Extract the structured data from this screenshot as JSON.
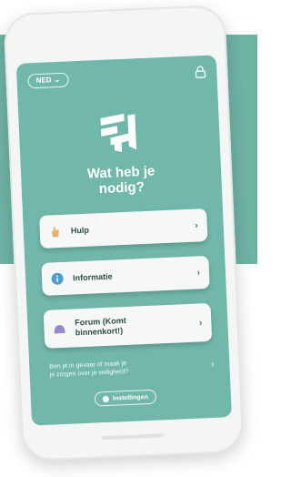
{
  "header": {
    "language_label": "NED",
    "language_caret": "⌄",
    "top_right_icon": "lock-icon"
  },
  "main": {
    "title_line1": "Wat heb je",
    "title_line2": "nodig?"
  },
  "options": [
    {
      "label": "Hulp",
      "icon": "hand-icon",
      "chevron": "›"
    },
    {
      "label": "Informatie",
      "icon": "info-icon",
      "chevron": "›"
    },
    {
      "label_line1": "Forum (Komt",
      "label_line2": "binnenkort!)",
      "icon": "chat-bubbles-icon",
      "chevron": "›"
    }
  ],
  "footer": {
    "note_line1": "Ben je in gevaar of maak je",
    "note_line2": "je zorgen over je veiligheid?",
    "note_chevron": "›",
    "pill_label": "Instellingen"
  },
  "colors": {
    "brand": "#72b8aa",
    "band": "#6fb3a5",
    "card": "#f6f8f7",
    "hand_icon": "#e8b16a",
    "info_icon": "#4a9fd0",
    "chat_icon": "#9a86c8"
  }
}
